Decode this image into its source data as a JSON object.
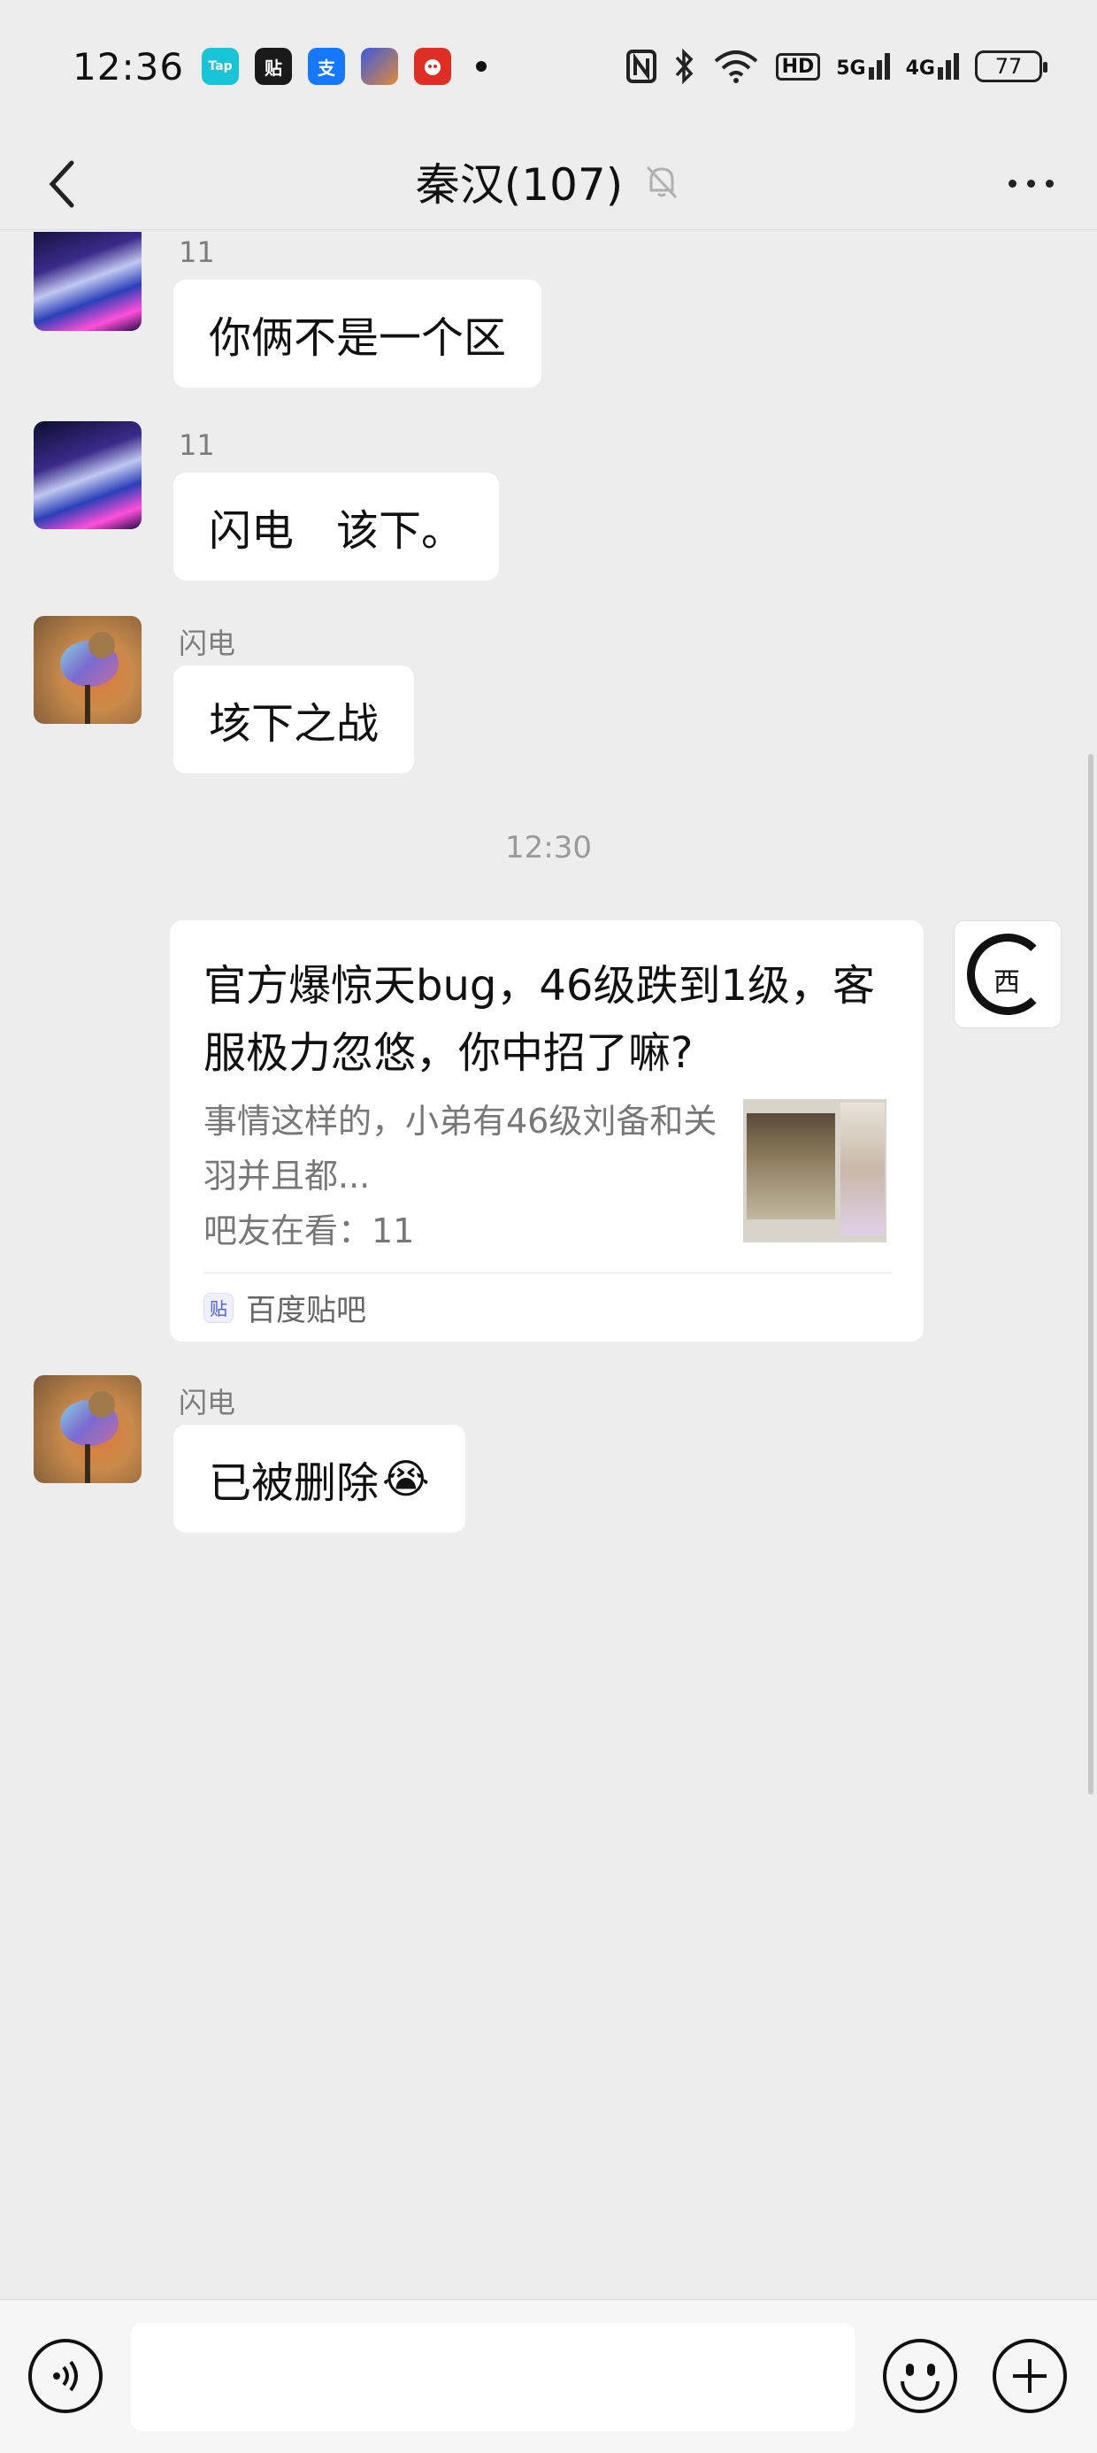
{
  "status_bar": {
    "time": "12:36",
    "apps": [
      {
        "icon": "taptap-icon",
        "label": "Tap",
        "color": "#18c5d6"
      },
      {
        "icon": "tieba-icon",
        "label": "贴",
        "color": "#1a1a1a"
      },
      {
        "icon": "alipay-icon",
        "label": "支",
        "color": "#1677ff"
      },
      {
        "icon": "game-icon",
        "label": "",
        "color": "#3a5ae0"
      },
      {
        "icon": "pdd-icon",
        "label": "",
        "color": "#e02e24"
      }
    ],
    "network_5g": "5G",
    "network_4g": "4G",
    "hd_label": "HD",
    "battery": "77"
  },
  "header": {
    "title": "秦汉(107)",
    "muted": true
  },
  "messages": [
    {
      "sender": "11",
      "text": "你俩不是一个区",
      "avatar": "anime-avatar"
    },
    {
      "sender": "11",
      "text": "闪电　该下。",
      "avatar": "anime-avatar"
    },
    {
      "sender": "闪电",
      "text": "垓下之战",
      "avatar": "bird-avatar"
    },
    {
      "sender": "闪电",
      "text": "已被删除",
      "emoji": "😭",
      "avatar": "bird-avatar"
    }
  ],
  "time_divider": "12:30",
  "shared_card": {
    "title": "官方爆惊天bug，46级跌到1级，客服极力忽悠，你中招了嘛?",
    "summary": "事情这样的，小弟有46级刘备和关羽并且都...",
    "meta": "吧友在看：11",
    "source": "百度贴吧",
    "avatar_glyph": "西"
  },
  "input": {
    "placeholder": "",
    "value": ""
  },
  "colors": {
    "background": "#ededed",
    "bubble": "#ffffff",
    "muted_text": "#7d7d7d"
  }
}
